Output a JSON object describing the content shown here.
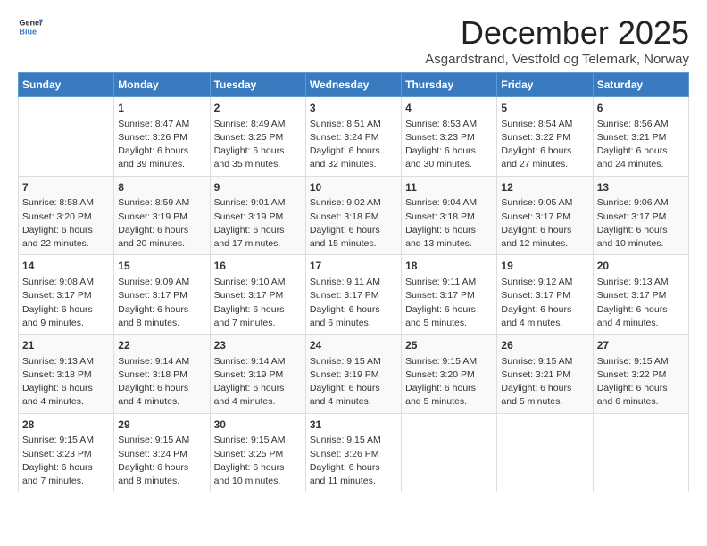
{
  "header": {
    "logo_line1": "General",
    "logo_line2": "Blue",
    "title": "December 2025",
    "subtitle": "Asgardstrand, Vestfold og Telemark, Norway"
  },
  "days_of_week": [
    "Sunday",
    "Monday",
    "Tuesday",
    "Wednesday",
    "Thursday",
    "Friday",
    "Saturday"
  ],
  "weeks": [
    [
      {
        "day": "",
        "info": ""
      },
      {
        "day": "1",
        "info": "Sunrise: 8:47 AM\nSunset: 3:26 PM\nDaylight: 6 hours\nand 39 minutes."
      },
      {
        "day": "2",
        "info": "Sunrise: 8:49 AM\nSunset: 3:25 PM\nDaylight: 6 hours\nand 35 minutes."
      },
      {
        "day": "3",
        "info": "Sunrise: 8:51 AM\nSunset: 3:24 PM\nDaylight: 6 hours\nand 32 minutes."
      },
      {
        "day": "4",
        "info": "Sunrise: 8:53 AM\nSunset: 3:23 PM\nDaylight: 6 hours\nand 30 minutes."
      },
      {
        "day": "5",
        "info": "Sunrise: 8:54 AM\nSunset: 3:22 PM\nDaylight: 6 hours\nand 27 minutes."
      },
      {
        "day": "6",
        "info": "Sunrise: 8:56 AM\nSunset: 3:21 PM\nDaylight: 6 hours\nand 24 minutes."
      }
    ],
    [
      {
        "day": "7",
        "info": "Sunrise: 8:58 AM\nSunset: 3:20 PM\nDaylight: 6 hours\nand 22 minutes."
      },
      {
        "day": "8",
        "info": "Sunrise: 8:59 AM\nSunset: 3:19 PM\nDaylight: 6 hours\nand 20 minutes."
      },
      {
        "day": "9",
        "info": "Sunrise: 9:01 AM\nSunset: 3:19 PM\nDaylight: 6 hours\nand 17 minutes."
      },
      {
        "day": "10",
        "info": "Sunrise: 9:02 AM\nSunset: 3:18 PM\nDaylight: 6 hours\nand 15 minutes."
      },
      {
        "day": "11",
        "info": "Sunrise: 9:04 AM\nSunset: 3:18 PM\nDaylight: 6 hours\nand 13 minutes."
      },
      {
        "day": "12",
        "info": "Sunrise: 9:05 AM\nSunset: 3:17 PM\nDaylight: 6 hours\nand 12 minutes."
      },
      {
        "day": "13",
        "info": "Sunrise: 9:06 AM\nSunset: 3:17 PM\nDaylight: 6 hours\nand 10 minutes."
      }
    ],
    [
      {
        "day": "14",
        "info": "Sunrise: 9:08 AM\nSunset: 3:17 PM\nDaylight: 6 hours\nand 9 minutes."
      },
      {
        "day": "15",
        "info": "Sunrise: 9:09 AM\nSunset: 3:17 PM\nDaylight: 6 hours\nand 8 minutes."
      },
      {
        "day": "16",
        "info": "Sunrise: 9:10 AM\nSunset: 3:17 PM\nDaylight: 6 hours\nand 7 minutes."
      },
      {
        "day": "17",
        "info": "Sunrise: 9:11 AM\nSunset: 3:17 PM\nDaylight: 6 hours\nand 6 minutes."
      },
      {
        "day": "18",
        "info": "Sunrise: 9:11 AM\nSunset: 3:17 PM\nDaylight: 6 hours\nand 5 minutes."
      },
      {
        "day": "19",
        "info": "Sunrise: 9:12 AM\nSunset: 3:17 PM\nDaylight: 6 hours\nand 4 minutes."
      },
      {
        "day": "20",
        "info": "Sunrise: 9:13 AM\nSunset: 3:17 PM\nDaylight: 6 hours\nand 4 minutes."
      }
    ],
    [
      {
        "day": "21",
        "info": "Sunrise: 9:13 AM\nSunset: 3:18 PM\nDaylight: 6 hours\nand 4 minutes."
      },
      {
        "day": "22",
        "info": "Sunrise: 9:14 AM\nSunset: 3:18 PM\nDaylight: 6 hours\nand 4 minutes."
      },
      {
        "day": "23",
        "info": "Sunrise: 9:14 AM\nSunset: 3:19 PM\nDaylight: 6 hours\nand 4 minutes."
      },
      {
        "day": "24",
        "info": "Sunrise: 9:15 AM\nSunset: 3:19 PM\nDaylight: 6 hours\nand 4 minutes."
      },
      {
        "day": "25",
        "info": "Sunrise: 9:15 AM\nSunset: 3:20 PM\nDaylight: 6 hours\nand 5 minutes."
      },
      {
        "day": "26",
        "info": "Sunrise: 9:15 AM\nSunset: 3:21 PM\nDaylight: 6 hours\nand 5 minutes."
      },
      {
        "day": "27",
        "info": "Sunrise: 9:15 AM\nSunset: 3:22 PM\nDaylight: 6 hours\nand 6 minutes."
      }
    ],
    [
      {
        "day": "28",
        "info": "Sunrise: 9:15 AM\nSunset: 3:23 PM\nDaylight: 6 hours\nand 7 minutes."
      },
      {
        "day": "29",
        "info": "Sunrise: 9:15 AM\nSunset: 3:24 PM\nDaylight: 6 hours\nand 8 minutes."
      },
      {
        "day": "30",
        "info": "Sunrise: 9:15 AM\nSunset: 3:25 PM\nDaylight: 6 hours\nand 10 minutes."
      },
      {
        "day": "31",
        "info": "Sunrise: 9:15 AM\nSunset: 3:26 PM\nDaylight: 6 hours\nand 11 minutes."
      },
      {
        "day": "",
        "info": ""
      },
      {
        "day": "",
        "info": ""
      },
      {
        "day": "",
        "info": ""
      }
    ]
  ]
}
